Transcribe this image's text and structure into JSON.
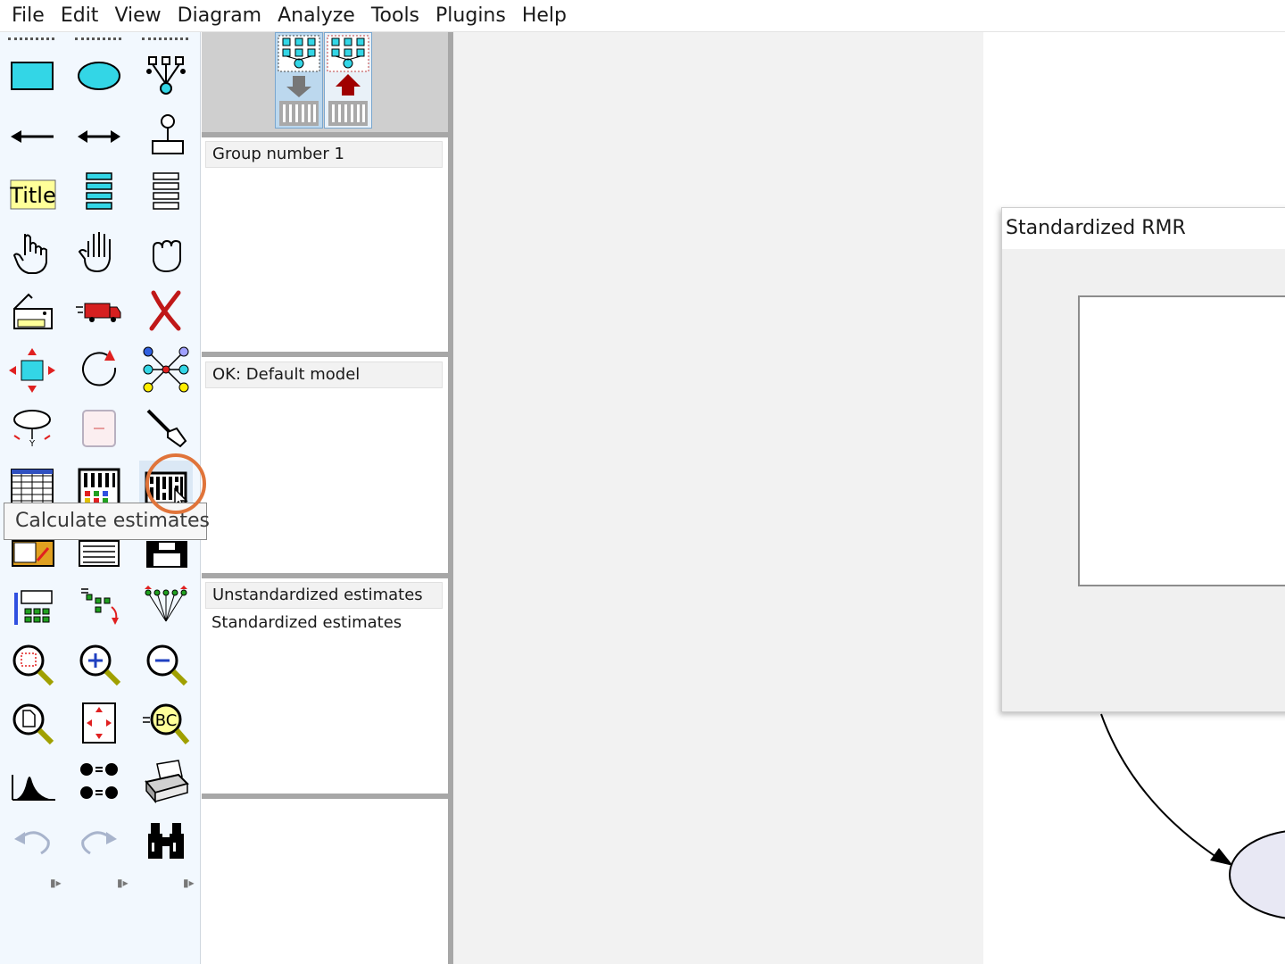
{
  "menu": [
    "File",
    "Edit",
    "View",
    "Diagram",
    "Analyze",
    "Tools",
    "Plugins",
    "Help"
  ],
  "toolbox": {
    "title_tool_label": "Title",
    "abc_label": "BC",
    "tooltip": "Calculate estimates",
    "highlight_color": "#e0743a",
    "tools": [
      "draw-observed-variable",
      "draw-latent-variable",
      "draw-latent-indicators",
      "draw-path",
      "draw-covariance",
      "add-unique-variable",
      "figure-caption",
      "list-variables-in-model",
      "list-variables-in-dataset",
      "select-one-object",
      "select-all-objects",
      "deselect-all-objects",
      "duplicate-objects",
      "move-objects",
      "erase-objects",
      "change-shape",
      "rotate-indicators",
      "reflect-indicators",
      "move-parameter-values",
      "reposition-diagram",
      "touch-up-variable",
      "select-data-files",
      "analysis-properties",
      "calculate-estimates",
      "copy-diagram-to-clipboard",
      "view-text-output",
      "save-diagram",
      "object-properties",
      "drag-properties",
      "preserve-symmetries",
      "zoom-in-on-area",
      "zoom-in",
      "zoom-out",
      "view-page",
      "fit-to-page",
      "magnify",
      "bayesian-estimation",
      "multiple-group-analysis",
      "print-diagram",
      "undo",
      "redo",
      "specification-search"
    ]
  },
  "path_panel": {
    "input_label": "view-input-path-diagram",
    "output_label": "view-output-path-diagram",
    "input_color": "#777777",
    "output_color": "#a00000"
  },
  "groups": {
    "header": "Group number 1"
  },
  "models": {
    "header": "OK: Default model"
  },
  "estimates": {
    "header": "Unstandardized estimates",
    "items": [
      "Standardized estimates"
    ]
  },
  "dialog": {
    "title": "Standardized RMR",
    "text_value": ""
  }
}
